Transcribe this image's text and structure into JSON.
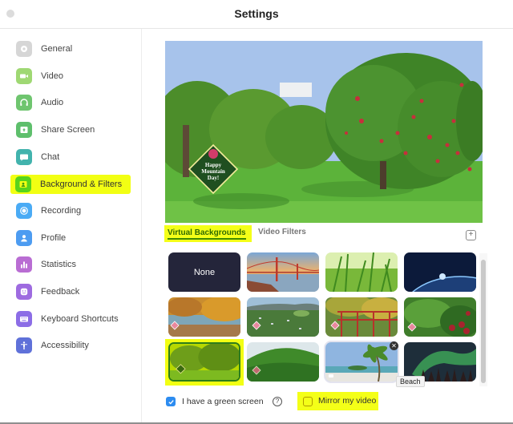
{
  "window": {
    "title": "Settings"
  },
  "sidebar": {
    "items": [
      {
        "label": "General",
        "icon": "gear-icon",
        "color": "#d3d3d3"
      },
      {
        "label": "Video",
        "icon": "video-camera-icon",
        "color": "#9bd66e"
      },
      {
        "label": "Audio",
        "icon": "headphones-icon",
        "color": "#6cc46c"
      },
      {
        "label": "Share Screen",
        "icon": "share-screen-icon",
        "color": "#5cbf6a"
      },
      {
        "label": "Chat",
        "icon": "chat-bubble-icon",
        "color": "#3fb3ad"
      },
      {
        "label": "Background & Filters",
        "icon": "background-person-icon",
        "color": "#56d61f",
        "active": true
      },
      {
        "label": "Recording",
        "icon": "record-icon",
        "color": "#47a9f5"
      },
      {
        "label": "Profile",
        "icon": "person-icon",
        "color": "#4a9af0"
      },
      {
        "label": "Statistics",
        "icon": "bar-chart-icon",
        "color": "#b76bd1"
      },
      {
        "label": "Feedback",
        "icon": "smiley-icon",
        "color": "#9c6ae0"
      },
      {
        "label": "Keyboard Shortcuts",
        "icon": "keyboard-icon",
        "color": "#8a6be6"
      },
      {
        "label": "Accessibility",
        "icon": "accessibility-icon",
        "color": "#5d6fd8"
      }
    ]
  },
  "preview": {
    "badge_text": [
      "Happy",
      "Mountain",
      "Day!"
    ]
  },
  "tabs": {
    "virtual_backgrounds": "Virtual Backgrounds",
    "video_filters": "Video Filters",
    "active": "Virtual Backgrounds"
  },
  "add_button": {
    "icon": "plus-icon"
  },
  "backgrounds": [
    {
      "name": "None"
    },
    {
      "name": "Golden Gate Bridge"
    },
    {
      "name": "Grass"
    },
    {
      "name": "Earth from space"
    },
    {
      "name": "Autumn lake",
      "badge": true
    },
    {
      "name": "Town aerial",
      "badge": true
    },
    {
      "name": "Red bridge",
      "badge": true
    },
    {
      "name": "Apple branch",
      "badge": true
    },
    {
      "name": "Orchard",
      "badge": true,
      "selected": true
    },
    {
      "name": "Green mountain",
      "badge": true
    },
    {
      "name": "Beach",
      "hovered": true
    },
    {
      "name": "Aurora"
    }
  ],
  "tooltip": "Beach",
  "options": {
    "green_screen_label": "I have a green screen",
    "green_screen_checked": true,
    "help_icon": "?",
    "mirror_label": "Mirror my video",
    "mirror_checked": false
  },
  "colors": {
    "highlight": "#f2ff13",
    "checkbox": "#2d8cf0",
    "none_tile": "#24253a"
  }
}
